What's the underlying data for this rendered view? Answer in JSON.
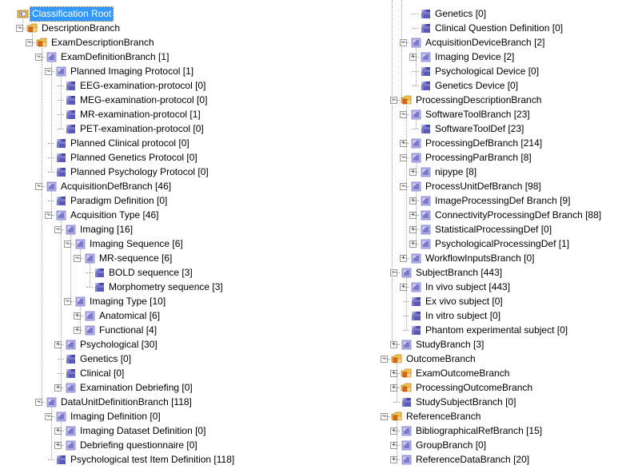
{
  "tree": {
    "columns": [
      [
        {
          "label": "Classification Root",
          "level": 0,
          "icon": "root-icon",
          "expander": "none",
          "selected": true
        },
        {
          "label": "DescriptionBranch",
          "level": 1,
          "icon": "branch-folder-icon",
          "expander": "minus"
        },
        {
          "label": "ExamDescriptionBranch",
          "level": 2,
          "icon": "branch-folder-icon",
          "expander": "minus"
        },
        {
          "label": "ExamDefinitionBranch  [1]",
          "level": 3,
          "icon": "class-icon",
          "expander": "minus"
        },
        {
          "label": "Planned Imaging Protocol  [1]",
          "level": 4,
          "icon": "class-icon",
          "expander": "minus"
        },
        {
          "label": "EEG-examination-protocol  [0]",
          "level": 5,
          "icon": "leaf-class-icon",
          "expander": "none"
        },
        {
          "label": "MEG-examination-protocol  [0]",
          "level": 5,
          "icon": "leaf-class-icon",
          "expander": "none"
        },
        {
          "label": "MR-examination-protocol  [1]",
          "level": 5,
          "icon": "leaf-class-icon",
          "expander": "none"
        },
        {
          "label": "PET-examination-protocol  [0]",
          "level": 5,
          "icon": "leaf-class-icon",
          "expander": "none"
        },
        {
          "label": "Planned Clinical protocol  [0]",
          "level": 4,
          "icon": "leaf-class-icon",
          "expander": "none"
        },
        {
          "label": "Planned Genetics Protocol  [0]",
          "level": 4,
          "icon": "leaf-class-icon",
          "expander": "none"
        },
        {
          "label": "Planned Psychology Protocol  [0]",
          "level": 4,
          "icon": "leaf-class-icon",
          "expander": "none"
        },
        {
          "label": "AcquisitionDefBranch  [46]",
          "level": 3,
          "icon": "class-icon",
          "expander": "minus"
        },
        {
          "label": "Paradigm Definition  [0]",
          "level": 4,
          "icon": "leaf-class-icon",
          "expander": "none"
        },
        {
          "label": "Acquisition Type  [46]",
          "level": 4,
          "icon": "class-icon",
          "expander": "minus"
        },
        {
          "label": "Imaging  [16]",
          "level": 5,
          "icon": "class-icon",
          "expander": "minus"
        },
        {
          "label": "Imaging Sequence  [6]",
          "level": 6,
          "icon": "class-icon",
          "expander": "minus"
        },
        {
          "label": "MR-sequence  [6]",
          "level": 7,
          "icon": "class-icon",
          "expander": "minus"
        },
        {
          "label": "BOLD sequence  [3]",
          "level": 8,
          "icon": "leaf-class-icon",
          "expander": "none"
        },
        {
          "label": "Morphometry sequence  [3]",
          "level": 8,
          "icon": "leaf-class-icon",
          "expander": "none"
        },
        {
          "label": "Imaging Type  [10]",
          "level": 6,
          "icon": "class-icon",
          "expander": "minus"
        },
        {
          "label": "Anatomical  [6]",
          "level": 7,
          "icon": "class-icon",
          "expander": "plus"
        },
        {
          "label": "Functional  [4]",
          "level": 7,
          "icon": "class-icon",
          "expander": "plus"
        },
        {
          "label": "Psychological  [30]",
          "level": 5,
          "icon": "class-icon",
          "expander": "plus"
        },
        {
          "label": "Genetics  [0]",
          "level": 5,
          "icon": "leaf-class-icon",
          "expander": "none"
        },
        {
          "label": "Clinical  [0]",
          "level": 5,
          "icon": "leaf-class-icon",
          "expander": "none"
        },
        {
          "label": "Examination Debriefing  [0]",
          "level": 5,
          "icon": "class-icon",
          "expander": "plus"
        },
        {
          "label": "DataUnitDefinitionBranch  [118]",
          "level": 3,
          "icon": "class-icon",
          "expander": "minus"
        },
        {
          "label": "Imaging Definition  [0]",
          "level": 4,
          "icon": "class-icon",
          "expander": "minus"
        },
        {
          "label": "Imaging Dataset Definition  [0]",
          "level": 5,
          "icon": "class-icon",
          "expander": "plus"
        },
        {
          "label": "Debriefing questionnaire  [0]",
          "level": 5,
          "icon": "class-icon",
          "expander": "plus"
        },
        {
          "label": "Psychological test Item Definition  [118]",
          "level": 4,
          "icon": "leaf-class-icon",
          "expander": "none"
        }
      ],
      [
        {
          "label": "Genetics  [0]",
          "level": 3,
          "icon": "leaf-class-icon",
          "expander": "none"
        },
        {
          "label": "Clinical Question Definition  [0]",
          "level": 3,
          "icon": "leaf-class-icon",
          "expander": "none"
        },
        {
          "label": "AcquisitionDeviceBranch  [2]",
          "level": 2,
          "icon": "class-icon",
          "expander": "minus"
        },
        {
          "label": "Imaging Device  [2]",
          "level": 3,
          "icon": "class-icon",
          "expander": "plus"
        },
        {
          "label": "Psychological Device  [0]",
          "level": 3,
          "icon": "leaf-class-icon",
          "expander": "none"
        },
        {
          "label": "Genetics Device  [0]",
          "level": 3,
          "icon": "leaf-class-icon",
          "expander": "none"
        },
        {
          "label": "ProcessingDescriptionBranch",
          "level": 1,
          "icon": "branch-folder-icon",
          "expander": "minus"
        },
        {
          "label": "SoftwareToolBranch  [23]",
          "level": 2,
          "icon": "class-icon",
          "expander": "minus"
        },
        {
          "label": "SoftwareToolDef  [23]",
          "level": 3,
          "icon": "leaf-class-icon",
          "expander": "none"
        },
        {
          "label": "ProcessingDefBranch  [214]",
          "level": 2,
          "icon": "class-icon",
          "expander": "plus"
        },
        {
          "label": "ProcessingParBranch  [8]",
          "level": 2,
          "icon": "class-icon",
          "expander": "minus"
        },
        {
          "label": "nipype  [8]",
          "level": 3,
          "icon": "class-icon",
          "expander": "plus"
        },
        {
          "label": "ProcessUnitDefBranch  [98]",
          "level": 2,
          "icon": "class-icon",
          "expander": "minus"
        },
        {
          "label": "ImageProcessingDef Branch  [9]",
          "level": 3,
          "icon": "class-icon",
          "expander": "plus"
        },
        {
          "label": "ConnectivityProcessingDef Branch  [88]",
          "level": 3,
          "icon": "class-icon",
          "expander": "plus"
        },
        {
          "label": "StatisticalProcessingDef  [0]",
          "level": 3,
          "icon": "class-icon",
          "expander": "plus"
        },
        {
          "label": "PsychologicalProcessingDef  [1]",
          "level": 3,
          "icon": "class-icon",
          "expander": "plus"
        },
        {
          "label": "WorkflowInputsBranch  [0]",
          "level": 2,
          "icon": "class-icon",
          "expander": "plus"
        },
        {
          "label": "SubjectBranch  [443]",
          "level": 1,
          "icon": "class-icon",
          "expander": "minus"
        },
        {
          "label": "In vivo subject  [443]",
          "level": 2,
          "icon": "class-icon",
          "expander": "plus"
        },
        {
          "label": "Ex vivo subject  [0]",
          "level": 2,
          "icon": "leaf-class-icon",
          "expander": "none"
        },
        {
          "label": "In vitro subject  [0]",
          "level": 2,
          "icon": "leaf-class-icon",
          "expander": "none"
        },
        {
          "label": "Phantom experimental subject  [0]",
          "level": 2,
          "icon": "leaf-class-icon",
          "expander": "none"
        },
        {
          "label": "StudyBranch  [3]",
          "level": 1,
          "icon": "class-icon",
          "expander": "plus"
        },
        {
          "label": "OutcomeBranch",
          "level": 0,
          "icon": "branch-folder-icon",
          "expander": "minus"
        },
        {
          "label": "ExamOutcomeBranch",
          "level": 1,
          "icon": "branch-folder-icon",
          "expander": "plus"
        },
        {
          "label": "ProcessingOutcomeBranch",
          "level": 1,
          "icon": "branch-folder-icon",
          "expander": "plus"
        },
        {
          "label": "StudySubjectBranch  [0]",
          "level": 1,
          "icon": "leaf-class-icon",
          "expander": "none"
        },
        {
          "label": "ReferenceBranch",
          "level": 0,
          "icon": "branch-folder-icon",
          "expander": "minus"
        },
        {
          "label": "BibliographicalRefBranch  [15]",
          "level": 1,
          "icon": "class-icon",
          "expander": "plus"
        },
        {
          "label": "GroupBranch  [0]",
          "level": 1,
          "icon": "class-icon",
          "expander": "plus"
        },
        {
          "label": "ReferenceDataBranch  [20]",
          "level": 1,
          "icon": "class-icon",
          "expander": "plus"
        }
      ]
    ]
  },
  "colors": {
    "selection": "#3399ff",
    "folder": "#f2c14e",
    "folder_accent": "#e0621b",
    "class_icon": "#7b79c9",
    "class_icon_light": "#b7b5ea",
    "connector": "#a0a0a0"
  }
}
